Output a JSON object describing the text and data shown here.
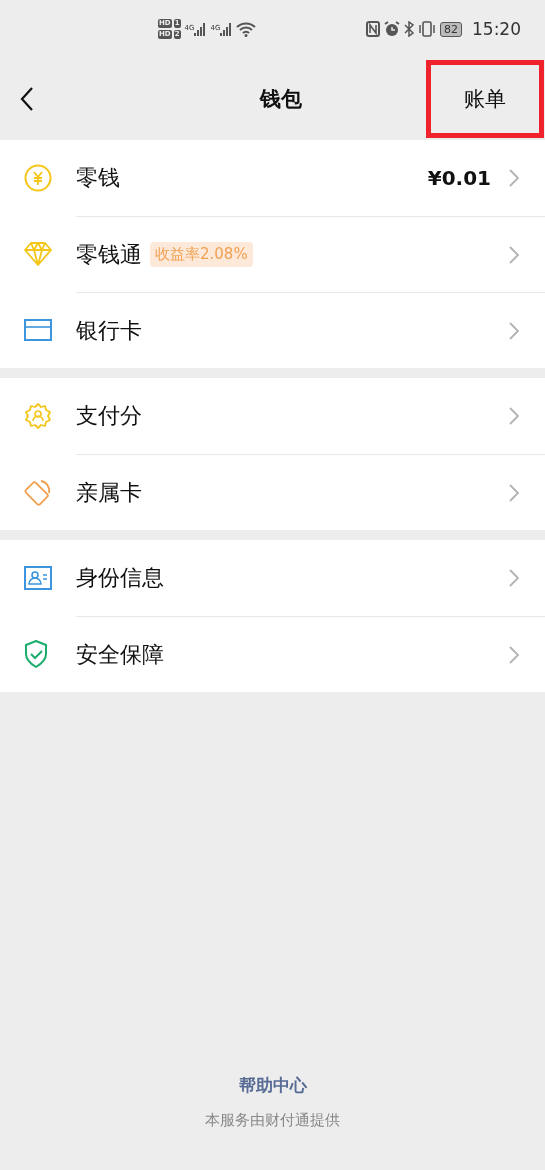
{
  "status_bar": {
    "sims": [
      {
        "hd": "HD",
        "slot": "1"
      },
      {
        "hd": "HD",
        "slot": "2"
      }
    ],
    "networks": [
      "4G",
      "4G"
    ],
    "battery": "82",
    "time": "15:20"
  },
  "nav": {
    "title": "钱包",
    "action": "账单",
    "action_highlighted": true
  },
  "groups": [
    {
      "items": [
        {
          "label": "零钱",
          "value": "¥0.01"
        },
        {
          "label": "零钱通",
          "badge": "收益率2.08%"
        },
        {
          "label": "银行卡"
        }
      ]
    },
    {
      "items": [
        {
          "label": "支付分"
        },
        {
          "label": "亲属卡"
        }
      ]
    },
    {
      "items": [
        {
          "label": "身份信息"
        },
        {
          "label": "安全保障"
        }
      ]
    }
  ],
  "footer": {
    "link": "帮助中心",
    "note": "本服务由财付通提供"
  }
}
